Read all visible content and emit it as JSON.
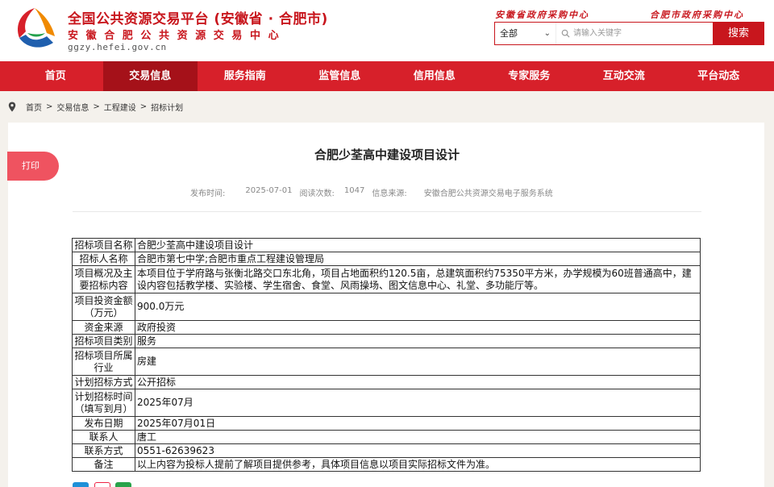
{
  "header": {
    "title": "全国公共资源交易平台 (安徽省 · 合肥市)",
    "subtitle": "安徽合肥公共资源交易中心",
    "url": "ggzy.hefei.gov.cn",
    "links": [
      "安徽省政府采购中心",
      "合肥市政府采购中心"
    ],
    "search": {
      "select_value": "全部",
      "placeholder": "请输入关键字",
      "button_label": "搜索"
    },
    "colors": {
      "brand_red": "#c8161d",
      "nav_red": "#d7202a",
      "nav_active": "#a51119"
    }
  },
  "nav": {
    "items": [
      "首页",
      "交易信息",
      "服务指南",
      "监管信息",
      "信用信息",
      "专家服务",
      "互动交流",
      "平台动态"
    ],
    "active": "交易信息"
  },
  "breadcrumb": [
    "首页",
    "交易信息",
    "工程建设",
    "招标计划"
  ],
  "print_label": "打印",
  "article": {
    "title": "合肥少荃高中建设项目设计",
    "meta": {
      "time_label": "发布时间:",
      "time_value": "2025-07-01",
      "views_label": "阅读次数:",
      "views_value": "1047",
      "source_label": "信息来源:",
      "source_value": "安徽合肥公共资源交易电子服务系统"
    },
    "table": [
      {
        "key": "招标项目名称",
        "value": "合肥少荃高中建设项目设计"
      },
      {
        "key": "招标人名称",
        "value": "合肥市第七中学;合肥市重点工程建设管理局"
      },
      {
        "key": "项目概况及主要招标内容",
        "value": "本项目位于学府路与张衡北路交口东北角，项目占地面积约120.5亩，总建筑面积约75350平方米，办学规模为60班普通高中，建设内容包括教学楼、实验楼、学生宿舍、食堂、风雨操场、图文信息中心、礼堂、多功能厅等。"
      },
      {
        "key": "项目投资金额（万元）",
        "value": "900.0万元"
      },
      {
        "key": "资金来源",
        "value": "政府投资"
      },
      {
        "key": "招标项目类别",
        "value": "服务"
      },
      {
        "key": "招标项目所属行业",
        "value": "房建"
      },
      {
        "key": "计划招标方式",
        "value": "公开招标"
      },
      {
        "key": "计划招标时间（填写到月）",
        "value": "2025年07月"
      },
      {
        "key": "发布日期",
        "value": "2025年07月01日"
      },
      {
        "key": "联系人",
        "value": "唐工"
      },
      {
        "key": "联系方式",
        "value": "0551-62639623"
      },
      {
        "key": "备注",
        "value": "以上内容为投标人提前了解项目提供参考，具体项目信息以项目实际招标文件为准。"
      }
    ]
  }
}
